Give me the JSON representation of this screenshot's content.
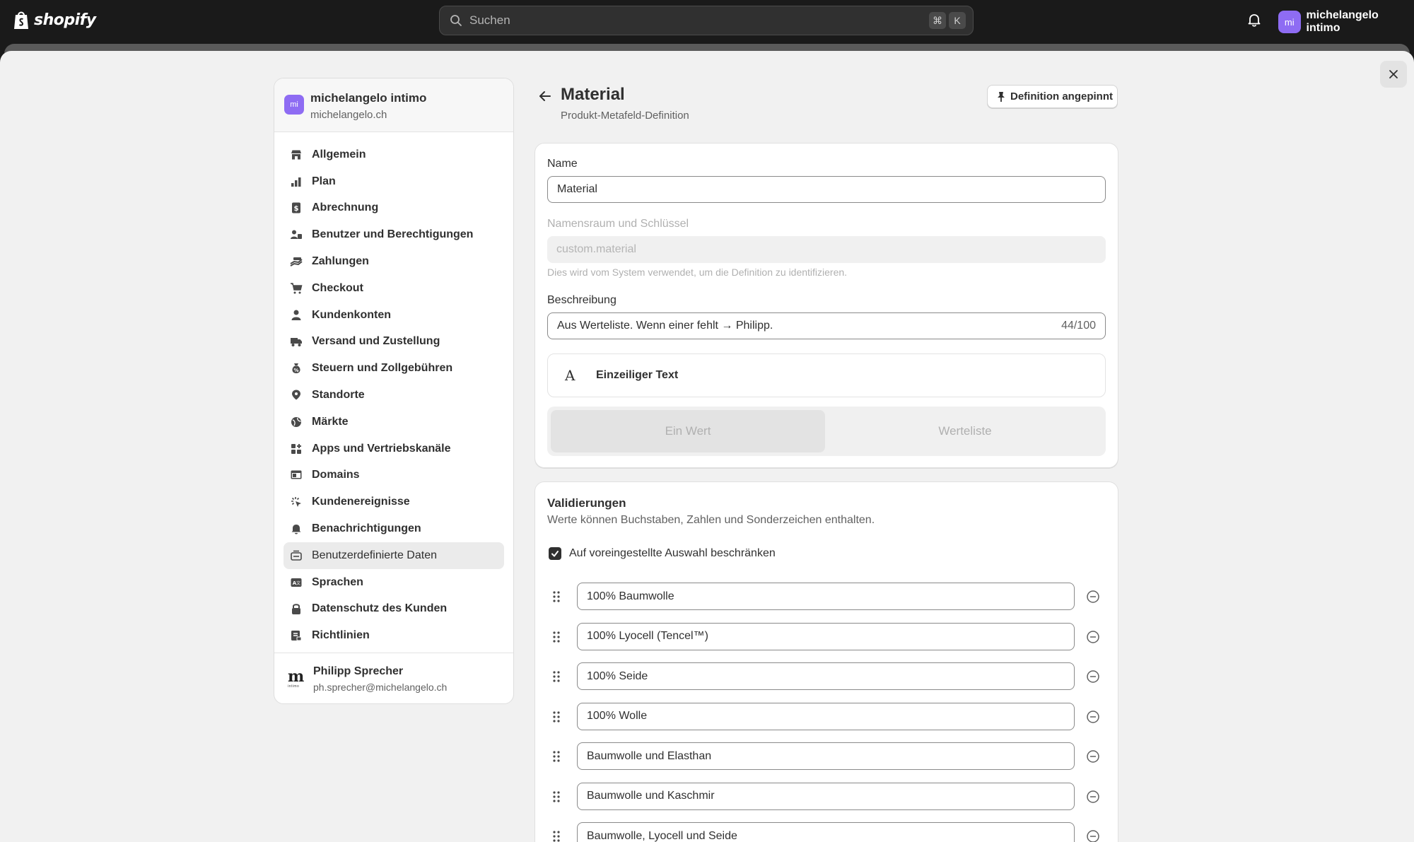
{
  "topbar": {
    "brand": "shopify",
    "search_placeholder": "Suchen",
    "shortcut_keys": [
      "⌘",
      "K"
    ],
    "user_initials": "mi",
    "user_name": "michelangelo intimo"
  },
  "sidebar": {
    "store_initials": "mi",
    "store_name": "michelangelo intimo",
    "store_domain": "michelangelo.ch",
    "items": [
      {
        "label": "Allgemein",
        "icon": "store-icon"
      },
      {
        "label": "Plan",
        "icon": "plan-icon"
      },
      {
        "label": "Abrechnung",
        "icon": "billing-icon"
      },
      {
        "label": "Benutzer und Berechtigungen",
        "icon": "users-icon"
      },
      {
        "label": "Zahlungen",
        "icon": "payments-icon"
      },
      {
        "label": "Checkout",
        "icon": "cart-icon"
      },
      {
        "label": "Kundenkonten",
        "icon": "person-icon"
      },
      {
        "label": "Versand und Zustellung",
        "icon": "truck-icon"
      },
      {
        "label": "Steuern und Zollgebühren",
        "icon": "tax-icon"
      },
      {
        "label": "Standorte",
        "icon": "location-icon"
      },
      {
        "label": "Märkte",
        "icon": "globe-icon"
      },
      {
        "label": "Apps und Vertriebskanäle",
        "icon": "apps-icon"
      },
      {
        "label": "Domains",
        "icon": "domain-icon"
      },
      {
        "label": "Kundenereignisse",
        "icon": "events-icon"
      },
      {
        "label": "Benachrichtigungen",
        "icon": "bell-icon"
      },
      {
        "label": "Benutzerdefinierte Daten",
        "icon": "custom-data-icon",
        "active": true
      },
      {
        "label": "Sprachen",
        "icon": "language-icon"
      },
      {
        "label": "Datenschutz des Kunden",
        "icon": "lock-icon"
      },
      {
        "label": "Richtlinien",
        "icon": "policy-icon"
      }
    ],
    "owner_name": "Philipp Sprecher",
    "owner_email": "ph.sprecher@michelangelo.ch",
    "owner_mark": "m",
    "owner_mark_sub": "intimo"
  },
  "page": {
    "title": "Material",
    "subtitle": "Produkt-Metafeld-Definition",
    "pin_label": "Definition angepinnt"
  },
  "definition": {
    "name_label": "Name",
    "name_value": "Material",
    "key_label": "Namensraum und Schlüssel",
    "key_value": "custom.material",
    "key_help": "Dies wird vom System verwendet, um die Definition zu identifizieren.",
    "desc_label": "Beschreibung",
    "desc_value": "Aus Werteliste. Wenn einer fehlt → Philipp.",
    "desc_counter": "44/100",
    "type_glyph": "A",
    "type_label": "Einzeiliger Text",
    "seg_single": "Ein Wert",
    "seg_list": "Werteliste"
  },
  "validations": {
    "title": "Validierungen",
    "subtitle": "Werte können Buchstaben, Zahlen und Sonderzeichen enthalten.",
    "restrict_label": "Auf voreingestellte Auswahl beschränken",
    "restrict_checked": true,
    "values": [
      "100% Baumwolle",
      "100% Lyocell (Tencel™)",
      "100% Seide",
      "100% Wolle",
      "Baumwolle und Elasthan",
      "Baumwolle und Kaschmir",
      "Baumwolle, Lyocell und Seide"
    ]
  },
  "colors": {
    "topbar": "#1a1a1a",
    "avatar": "#8e6cf3",
    "sheet": "#f1f1f1"
  }
}
